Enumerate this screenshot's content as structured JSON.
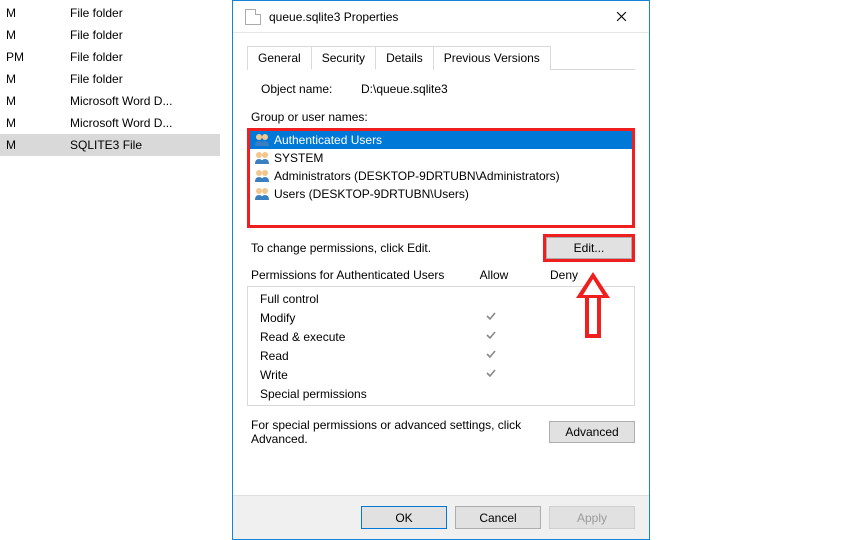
{
  "bg_rows": [
    {
      "time": "M",
      "type": "File folder",
      "selected": false
    },
    {
      "time": "M",
      "type": "File folder",
      "selected": false
    },
    {
      "time": "PM",
      "type": "File folder",
      "selected": false
    },
    {
      "time": "M",
      "type": "File folder",
      "selected": false
    },
    {
      "time": "M",
      "type": "Microsoft Word D...",
      "selected": false
    },
    {
      "time": "M",
      "type": "Microsoft Word D...",
      "selected": false
    },
    {
      "time": "M",
      "type": "SQLITE3 File",
      "selected": true
    }
  ],
  "dialog": {
    "title": "queue.sqlite3 Properties",
    "tabs": [
      {
        "label": "General",
        "active": false
      },
      {
        "label": "Security",
        "active": true
      },
      {
        "label": "Details",
        "active": false
      },
      {
        "label": "Previous Versions",
        "active": false
      }
    ],
    "object_name_label": "Object name:",
    "object_path": "D:\\queue.sqlite3",
    "group_label": "Group or user names:",
    "groups": [
      {
        "name": "Authenticated Users",
        "selected": true
      },
      {
        "name": "SYSTEM",
        "selected": false
      },
      {
        "name": "Administrators (DESKTOP-9DRTUBN\\Administrators)",
        "selected": false
      },
      {
        "name": "Users (DESKTOP-9DRTUBN\\Users)",
        "selected": false
      }
    ],
    "change_permissions_label": "To change permissions, click Edit.",
    "edit_button": "Edit...",
    "permissions_for_label": "Permissions for Authenticated Users",
    "allow_label": "Allow",
    "deny_label": "Deny",
    "permissions": [
      {
        "name": "Full control",
        "allow": false,
        "deny": false
      },
      {
        "name": "Modify",
        "allow": true,
        "deny": false
      },
      {
        "name": "Read & execute",
        "allow": true,
        "deny": false
      },
      {
        "name": "Read",
        "allow": true,
        "deny": false
      },
      {
        "name": "Write",
        "allow": true,
        "deny": false
      },
      {
        "name": "Special permissions",
        "allow": false,
        "deny": false
      }
    ],
    "advanced_label": "For special permissions or advanced settings, click Advanced.",
    "advanced_button": "Advanced",
    "ok_button": "OK",
    "cancel_button": "Cancel",
    "apply_button": "Apply"
  }
}
